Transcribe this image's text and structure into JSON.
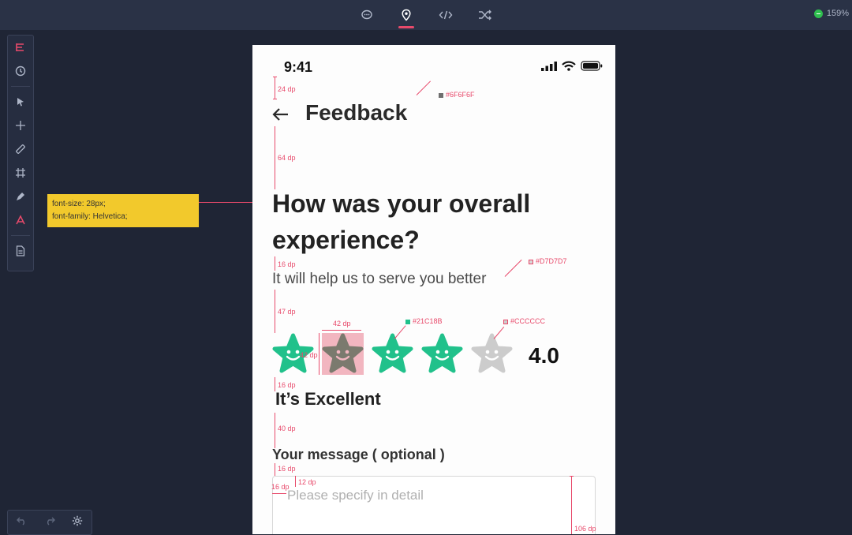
{
  "toolbar_top": {
    "tabs": [
      {
        "icon": "comment-icon",
        "active": false
      },
      {
        "icon": "location-pin-icon",
        "active": true
      },
      {
        "icon": "code-icon",
        "active": false
      },
      {
        "icon": "shuffle-icon",
        "active": false
      }
    ],
    "zoom_label": "159%"
  },
  "tooltip": {
    "line1": "font-size: 28px;",
    "line2": "font-family: Helvetica;"
  },
  "phone": {
    "time": "9:41",
    "title": "Feedback",
    "question": "How was your overall experience?",
    "subtitle": "It will help us to serve you better",
    "rating": "4.0",
    "rating_label": "It’s Excellent",
    "message_label": "Your message ( optional )",
    "message_placeholder": "Please specify in detail",
    "stars_filled": 4,
    "stars_total": 5
  },
  "annotations": {
    "d24": "24 dp",
    "d64": "64 dp",
    "d16a": "16 dp",
    "d47": "47 dp",
    "d42": "42 dp",
    "d42v": "42 dp",
    "d16b": "16 dp",
    "d40": "40 dp",
    "d16c": "16 dp",
    "d12": "12 dp",
    "d16d": "16 dp",
    "d106": "106 dp",
    "c_title": "#6F6F6F",
    "c_sub": "#D7D7D7",
    "c_star": "#21C18B",
    "c_empty": "#CCCCCC"
  },
  "colors": {
    "star_filled": "#21C18B",
    "star_empty": "#CCCCCC",
    "accent": "#E84A6B"
  }
}
